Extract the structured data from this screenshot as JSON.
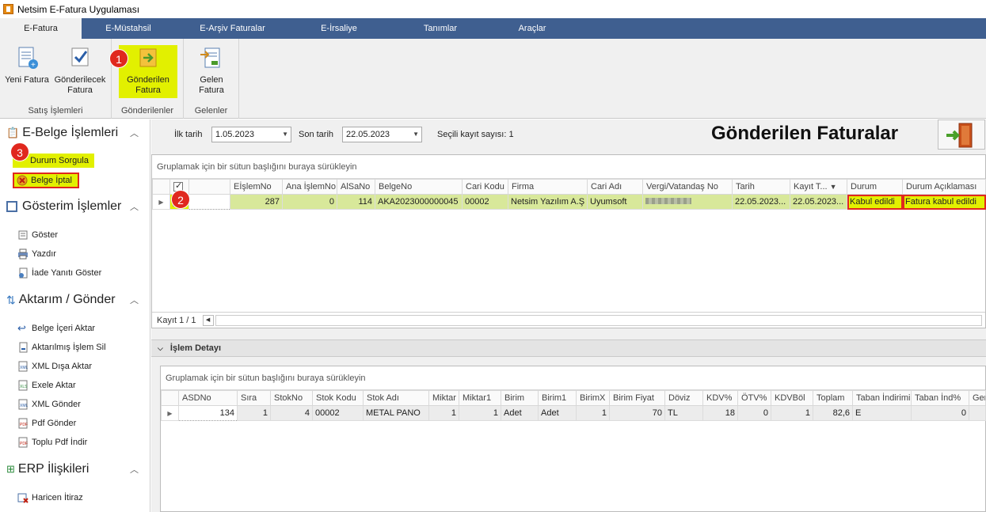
{
  "window": {
    "title": "Netsim E-Fatura Uygulaması"
  },
  "tabs": [
    "E-Fatura",
    "E-Müstahsil",
    "E-Arşiv Faturalar",
    "E-İrsaliye",
    "Tanımlar",
    "Araçlar"
  ],
  "ribbon": {
    "yeni_fatura": "Yeni Fatura",
    "gonderilecek_1": "Gönderilecek",
    "gonderilecek_2": "Fatura",
    "satis_group": "Satış İşlemleri",
    "gonderilen_1": "Gönderilen",
    "gonderilen_2": "Fatura",
    "gonderilenler_group": "Gönderilenler",
    "gelen_1": "Gelen",
    "gelen_2": "Fatura",
    "gelenler_group": "Gelenler"
  },
  "badges": {
    "b1": "1",
    "b2": "2",
    "b3": "3"
  },
  "sidebar": {
    "ebelge_title": "E-Belge İşlemleri",
    "durum_sorgula": "Durum Sorgula",
    "belge_iptal": "Belge İptal",
    "gosterim_title": "Gösterim İşlemler",
    "goster": "Göster",
    "yazdir": "Yazdır",
    "iade": "İade Yanıtı Göster",
    "aktarim_title": "Aktarım / Gönder",
    "belge_iceri": "Belge İçeri Aktar",
    "aktarilmis_sil": "Aktarılmış İşlem Sil",
    "xml_disa": "XML Dışa Aktar",
    "exele": "Exele Aktar",
    "xml_gonder": "XML Gönder",
    "pdf_gonder": "Pdf Gönder",
    "toplu_pdf": "Toplu Pdf İndir",
    "erp_title": "ERP İlişkileri",
    "haricen": "Haricen İtiraz"
  },
  "filter": {
    "ilk_label": "İlk tarih",
    "ilk_value": "1.05.2023",
    "son_label": "Son tarih",
    "son_value": "22.05.2023",
    "secili": "Seçili kayıt sayısı: 1"
  },
  "page_title": "Gönderilen Faturalar",
  "grid1": {
    "group_hint": "Gruplamak için bir sütun başlığını buraya sürükleyin",
    "headers": [
      "EİşlemNo",
      "Ana İşlemNo",
      "AlSaNo",
      "BelgeNo",
      "Cari Kodu",
      "Firma",
      "Cari Adı",
      "Vergi/Vatandaş No",
      "Tarih",
      "Kayıt T...",
      "Durum",
      "Durum Açıklaması"
    ],
    "row": {
      "eislemno": "287",
      "ana_islemno": "0",
      "alsano": "114",
      "belgeno": "AKA2023000000045",
      "cari_kodu": "00002",
      "firma": "Netsim Yazılım A.Ş",
      "cari_adi": "Uyumsoft",
      "vergi": "",
      "tarih": "22.05.2023...",
      "kayit": "22.05.2023...",
      "durum": "Kabul edildi",
      "durum_aciklama": "Fatura kabul edildi"
    },
    "footer": "Kayıt 1 / 1"
  },
  "detail": {
    "title": "İşlem Detayı",
    "group_hint": "Gruplamak için bir sütun başlığını buraya sürükleyin",
    "headers": [
      "ASDNo",
      "Sıra",
      "StokNo",
      "Stok Kodu",
      "Stok Adı",
      "Miktar",
      "Miktar1",
      "Birim",
      "Birim1",
      "BirimX",
      "Birim Fiyat",
      "Döviz",
      "KDV%",
      "ÖTV%",
      "KDVBöl",
      "Toplam",
      "Taban İndirimi",
      "Taban İnd%",
      "Ger"
    ],
    "row": [
      "134",
      "1",
      "4",
      "00002",
      "METAL PANO",
      "1",
      "1",
      "Adet",
      "Adet",
      "1",
      "70",
      "TL",
      "18",
      "0",
      "1",
      "82,6",
      "E",
      "0",
      ""
    ]
  }
}
